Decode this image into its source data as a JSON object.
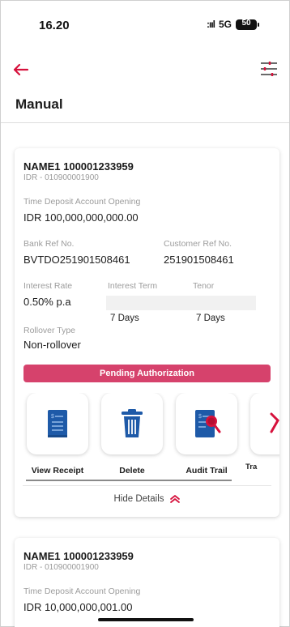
{
  "status_bar": {
    "time": "16.20",
    "signal": ":ııl",
    "network": "5G",
    "battery": "50"
  },
  "header": {
    "title": "Manual"
  },
  "icons": {
    "back": "arrow-left-icon",
    "filter": "filter-sliders-icon",
    "receipt": "receipt-icon",
    "delete": "trash-icon",
    "audit": "audit-document-icon",
    "toggle": "double-chevron-up-icon"
  },
  "colors": {
    "accent": "#d6426c",
    "back_arrow": "#d6113c",
    "icon_blue": "#1e5aa8"
  },
  "cards": [
    {
      "account_name": "NAME1 100001233959",
      "account_sub": "IDR - 010900001900",
      "product_label": "Time Deposit Account Opening",
      "amount": "IDR 100,000,000,000.00",
      "bank_ref_label": "Bank Ref No.",
      "bank_ref": "BVTDO251901508461",
      "customer_ref_label": "Customer Ref No.",
      "customer_ref": "251901508461",
      "interest_rate_label": "Interest Rate",
      "interest_rate": "0.50% p.a",
      "interest_term_label": "Interest Term",
      "interest_term": "7 Days",
      "tenor_label": "Tenor",
      "tenor": "7 Days",
      "rollover_label": "Rollover Type",
      "rollover": "Non-rollover",
      "status": "Pending Authorization",
      "actions": [
        {
          "label": "View Receipt"
        },
        {
          "label": "Delete"
        },
        {
          "label": "Audit Trail"
        },
        {
          "label": "Tra"
        }
      ],
      "toggle_label": "Hide Details"
    },
    {
      "account_name": "NAME1 100001233959",
      "account_sub": "IDR - 010900001900",
      "product_label": "Time Deposit Account Opening",
      "amount": "IDR 10,000,000,001.00"
    }
  ]
}
